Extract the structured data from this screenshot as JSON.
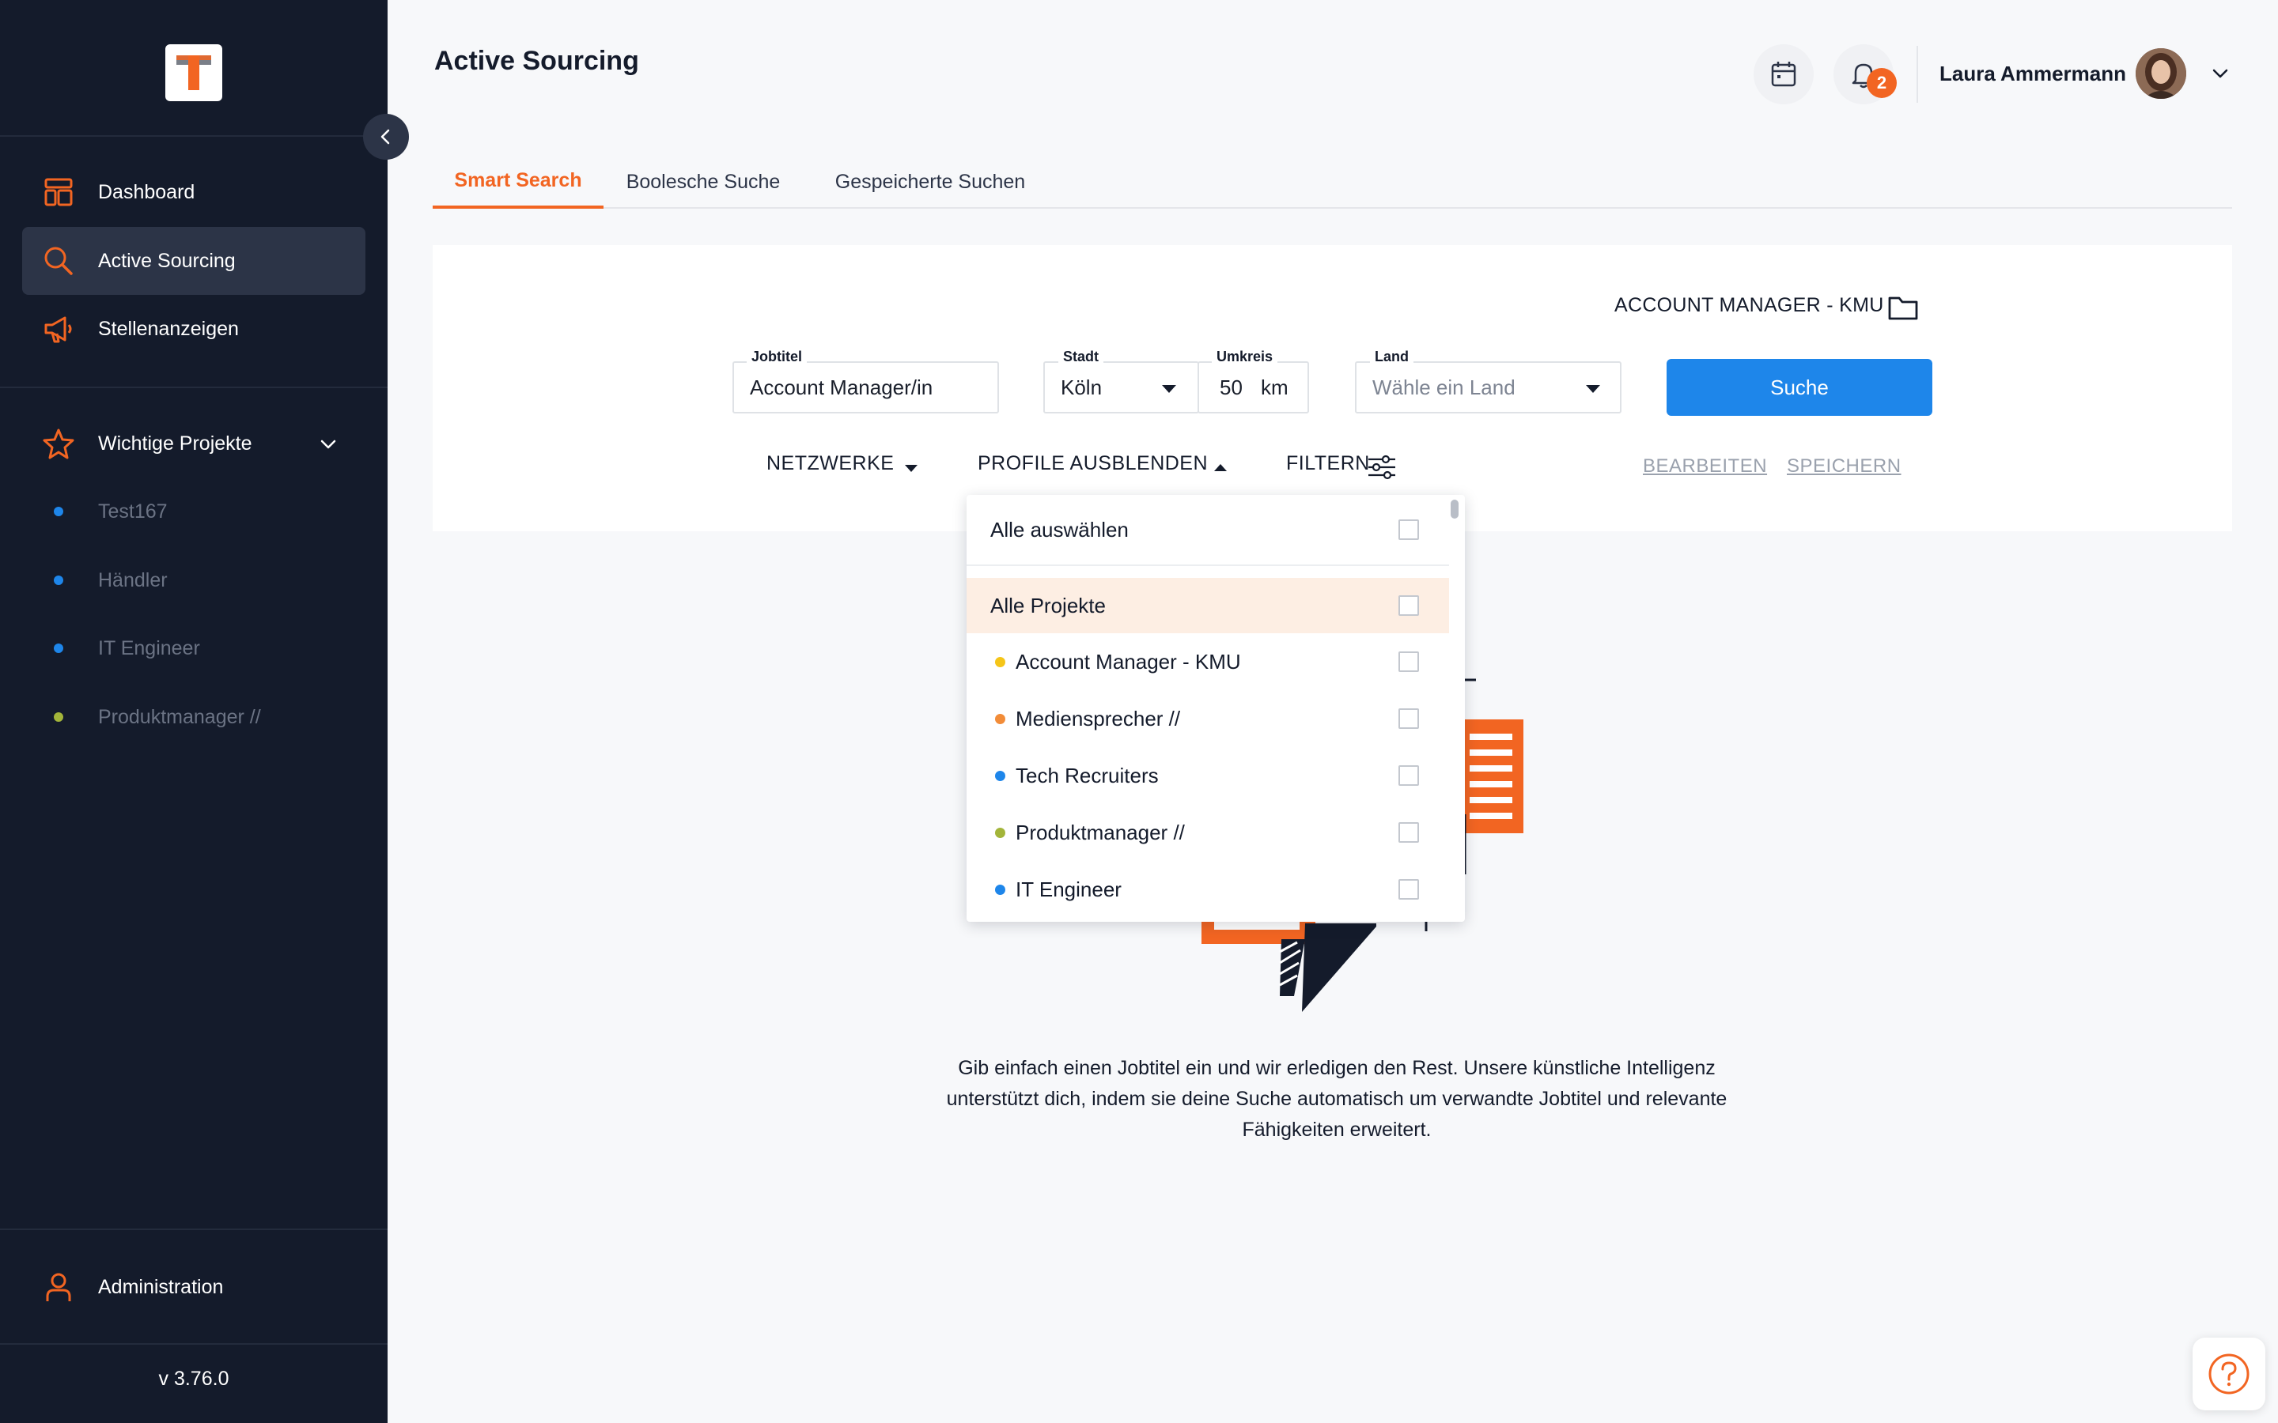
{
  "app": {
    "version": "v 3.76.0"
  },
  "sidebar": {
    "nav": [
      {
        "label": "Dashboard",
        "icon": "dashboard-icon"
      },
      {
        "label": "Active Sourcing",
        "icon": "search-icon",
        "active": true
      },
      {
        "label": "Stellenanzeigen",
        "icon": "megaphone-icon"
      }
    ],
    "favorites": {
      "label": "Wichtige Projekte",
      "icon": "star-icon"
    },
    "projects": [
      {
        "label": "Test167",
        "color": "#1e86ea"
      },
      {
        "label": "Händler",
        "color": "#1e86ea"
      },
      {
        "label": "IT Engineer",
        "color": "#1e86ea"
      },
      {
        "label": "Produktmanager //",
        "color": "#a3b53a"
      }
    ],
    "admin": {
      "label": "Administration",
      "icon": "user-icon"
    }
  },
  "header": {
    "title": "Active Sourcing",
    "notification_count": "2",
    "user_name": "Laura Ammermann"
  },
  "tabs": [
    {
      "label": "Smart Search",
      "active": true
    },
    {
      "label": "Boolesche Suche"
    },
    {
      "label": "Gespeicherte Suchen"
    }
  ],
  "search": {
    "project_tag": "ACCOUNT MANAGER - KMU",
    "jobtitle": {
      "label": "Jobtitel",
      "value": "Account Manager/in"
    },
    "city": {
      "label": "Stadt",
      "value": "Köln"
    },
    "radius": {
      "label": "Umkreis",
      "value": "50",
      "unit": "km"
    },
    "country": {
      "label": "Land",
      "placeholder": "Wähle ein Land"
    },
    "submit_label": "Suche",
    "filters": {
      "networks": "NETZWERKE",
      "hide_profiles": "PROFILE AUSBLENDEN",
      "filter": "FILTERN",
      "edit": "BEARBEITEN",
      "save": "SPEICHERN"
    }
  },
  "dropdown": {
    "select_all": "Alle auswählen",
    "all_projects": "Alle Projekte",
    "projects": [
      {
        "label": "Account Manager - KMU",
        "color": "#f5c518"
      },
      {
        "label": "Mediensprecher //",
        "color": "#f28c38"
      },
      {
        "label": "Tech Recruiters",
        "color": "#1e86ea"
      },
      {
        "label": "Produktmanager //",
        "color": "#a3b53a"
      },
      {
        "label": "IT Engineer",
        "color": "#1e86ea"
      }
    ]
  },
  "empty_state": {
    "text": "Gib einfach einen Jobtitel ein und wir erledigen den Rest. Unsere künstliche Intelligenz unterstützt dich, indem sie deine Suche automatisch um verwandte Jobtitel und relevante Fähigkeiten erweitert."
  },
  "colors": {
    "accent": "#f26522",
    "primary": "#1e86ea",
    "sidebar_bg": "#141b2b"
  }
}
